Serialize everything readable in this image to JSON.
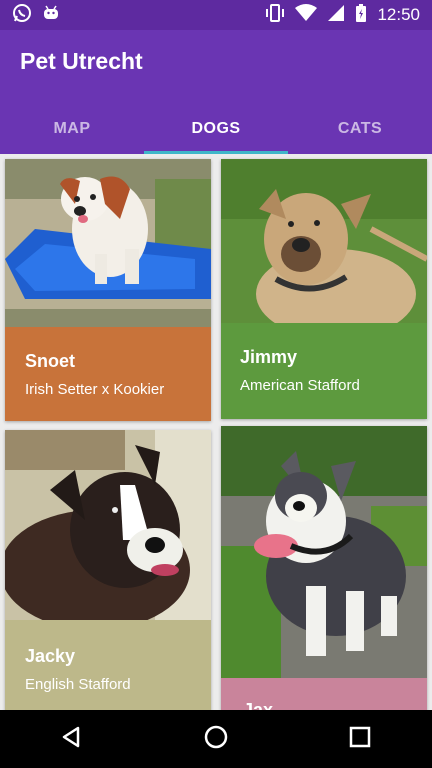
{
  "status_bar": {
    "time": "12:50",
    "left_icons": [
      "whatsapp-icon",
      "android-icon"
    ],
    "right_icons": [
      "vibrate-icon",
      "wifi-icon",
      "signal-icon",
      "battery-charging-icon"
    ]
  },
  "app": {
    "title": "Pet Utrecht",
    "tabs": [
      {
        "label": "MAP",
        "active": false
      },
      {
        "label": "DOGS",
        "active": true
      },
      {
        "label": "CATS",
        "active": false
      }
    ]
  },
  "dogs": [
    {
      "name": "Snoet",
      "breed": "Irish Setter x Kookier",
      "panel_color": "#c8733a"
    },
    {
      "name": "Jimmy",
      "breed": "American Stafford",
      "panel_color": "#5d9a3e"
    },
    {
      "name": "Jacky",
      "breed": "English Stafford",
      "panel_color": "#bdb88a"
    },
    {
      "name": "Jax",
      "breed": "",
      "panel_color": "#c9849b"
    }
  ],
  "colors": {
    "status_bar": "#5e2aa0",
    "app_bar": "#6a35b3",
    "tab_indicator": "#3fb6c9"
  },
  "nav_bar": {
    "icons": [
      "back-icon",
      "home-icon",
      "recents-icon"
    ]
  }
}
